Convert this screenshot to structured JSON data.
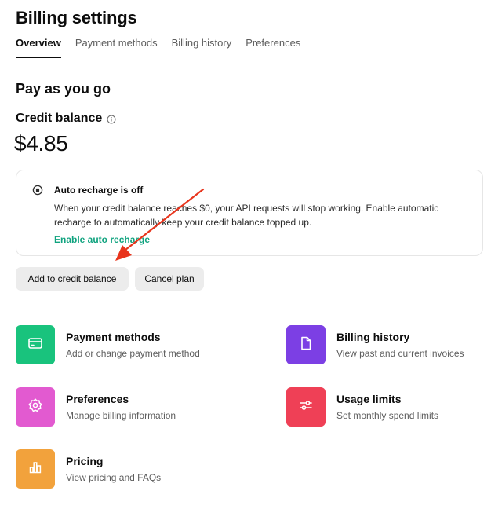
{
  "header": {
    "title": "Billing settings",
    "tabs": [
      {
        "label": "Overview",
        "active": true
      },
      {
        "label": "Payment methods",
        "active": false
      },
      {
        "label": "Billing history",
        "active": false
      },
      {
        "label": "Preferences",
        "active": false
      }
    ]
  },
  "plan": {
    "title": "Pay as you go",
    "credit_label": "Credit balance",
    "credit_amount": "$4.85"
  },
  "notice": {
    "title": "Auto recharge is off",
    "body": "When your credit balance reaches $0, your API requests will stop working. Enable automatic recharge to automatically keep your credit balance topped up.",
    "link": "Enable auto recharge"
  },
  "actions": {
    "add_label": "Add to credit balance",
    "cancel_label": "Cancel plan"
  },
  "cards": [
    {
      "title": "Payment methods",
      "subtitle": "Add or change payment method",
      "color": "#19c37d",
      "icon": "credit-card-icon"
    },
    {
      "title": "Billing history",
      "subtitle": "View past and current invoices",
      "color": "#7c3fe4",
      "icon": "document-icon"
    },
    {
      "title": "Preferences",
      "subtitle": "Manage billing information",
      "color": "#e25ad0",
      "icon": "gear-icon"
    },
    {
      "title": "Usage limits",
      "subtitle": "Set monthly spend limits",
      "color": "#ef4056",
      "icon": "sliders-icon"
    },
    {
      "title": "Pricing",
      "subtitle": "View pricing and FAQs",
      "color": "#f2a23c",
      "icon": "bar-chart-icon"
    }
  ],
  "annotation": {
    "arrow_color": "#e8341c"
  }
}
